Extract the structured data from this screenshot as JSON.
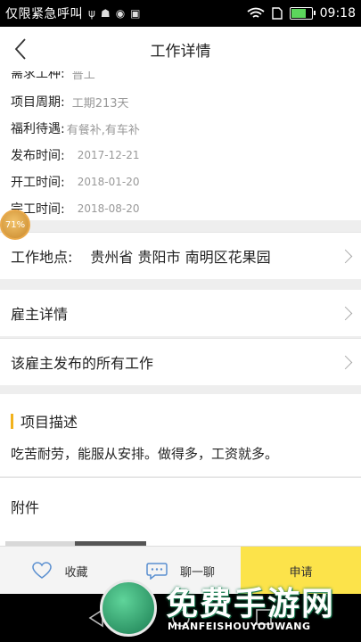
{
  "status_bar": {
    "carrier": "仅限紧急呼叫",
    "time": "09:18",
    "battery_level": 0.75,
    "icons": [
      "usb-icon",
      "android-debug-icon",
      "app-icon",
      "image-icon",
      "wifi-icon",
      "sim-icon",
      "battery-icon"
    ]
  },
  "header": {
    "title": "工作详情",
    "back_icon": "back-chevron-icon"
  },
  "info": {
    "partial_row": {
      "label": "需求工种:",
      "value": "普工"
    },
    "rows": [
      {
        "label": "项目周期:",
        "value": "工期213天"
      },
      {
        "label": "福利待遇:",
        "value": "有餐补,有车补"
      },
      {
        "label": "发布时间:",
        "value": "2017-12-21"
      },
      {
        "label": "开工时间:",
        "value": "2018-01-20"
      },
      {
        "label": "完工时间:",
        "value": "2018-08-20"
      }
    ]
  },
  "floating_badge": {
    "text": "71%"
  },
  "work_location": {
    "label": "工作地点:",
    "value": "贵州省 贵阳市 南明区花果园"
  },
  "links": {
    "employer_details": "雇主详情",
    "employer_all_jobs": "该雇主发布的所有工作"
  },
  "description": {
    "heading": "项目描述",
    "text": "吃苦耐劳，能服从安排。做得多，工资就多。",
    "accent_color": "#f2b21c"
  },
  "attachments": {
    "heading": "附件"
  },
  "actions": {
    "favorite": "收藏",
    "chat": "聊一聊",
    "apply": "申请",
    "apply_color": "#fce34a"
  },
  "watermark": {
    "title": "免费手游网",
    "subtitle": "MIANFEISHOUYOUWANG"
  }
}
